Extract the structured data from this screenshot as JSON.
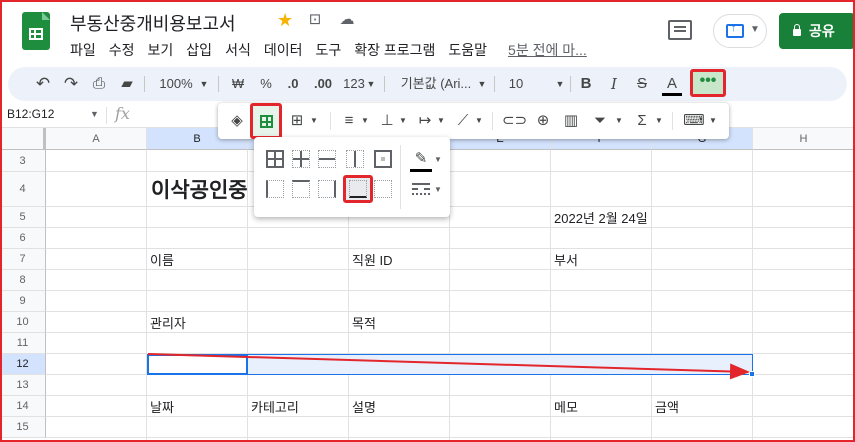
{
  "header": {
    "title": "부동산중개비용보고서",
    "menus": [
      "파일",
      "수정",
      "보기",
      "삽입",
      "서식",
      "데이터",
      "도구",
      "확장 프로그램",
      "도움말"
    ],
    "last_edit": "5분 전에 마...",
    "share_label": "공유"
  },
  "toolbar": {
    "zoom": "100%",
    "currency": "₩",
    "percent": "%",
    "dec_decrease": ".0",
    "dec_increase": ".00",
    "number_format": "123",
    "font": "기본값 (Ari...",
    "font_size": "10",
    "bold": "B",
    "italic": "I",
    "strike": "S",
    "text_color": "A",
    "more": "•••"
  },
  "formula_bar": {
    "name_box": "B12:G12",
    "fx": "fx"
  },
  "sheet": {
    "columns": [
      "A",
      "B",
      "C",
      "D",
      "E",
      "F",
      "G",
      "H"
    ],
    "rows": [
      "3",
      "4",
      "5",
      "6",
      "7",
      "8",
      "9",
      "10",
      "11",
      "12",
      "13",
      "14",
      "15"
    ],
    "selected_rows": [
      "12"
    ],
    "cells": {
      "b4": "이삭공인중",
      "f5": "2022년 2월 24일",
      "b7": "이름",
      "d7": "직원 ID",
      "f7": "부서",
      "b10": "관리자",
      "d10": "목적",
      "b14": "날짜",
      "c14": "카테고리",
      "d14": "설명",
      "f14": "메모",
      "g14": "금액"
    }
  },
  "colors": {
    "accent": "#1a73e8",
    "brand": "#1e8e3e",
    "highlight": "#e3262b",
    "toolbar_bg": "#edf2fa"
  }
}
